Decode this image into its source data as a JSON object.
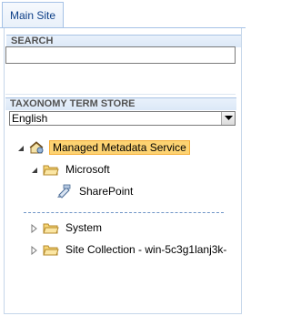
{
  "tabs": {
    "main_site": "Main Site"
  },
  "search": {
    "header": "SEARCH",
    "value": "",
    "placeholder": ""
  },
  "taxonomy": {
    "header": "TAXONOMY TERM STORE",
    "language_selected": "English"
  },
  "tree": {
    "root": "Managed Metadata Service",
    "group_microsoft": "Microsoft",
    "termset_sharepoint": "SharePoint",
    "group_system": "System",
    "group_site_collection": "Site Collection - win-5c3g1lanj3k-"
  },
  "colors": {
    "selected_bg": "#fdd372",
    "header_bg": "#dce8f7",
    "accent_border": "#a5c2e6"
  }
}
